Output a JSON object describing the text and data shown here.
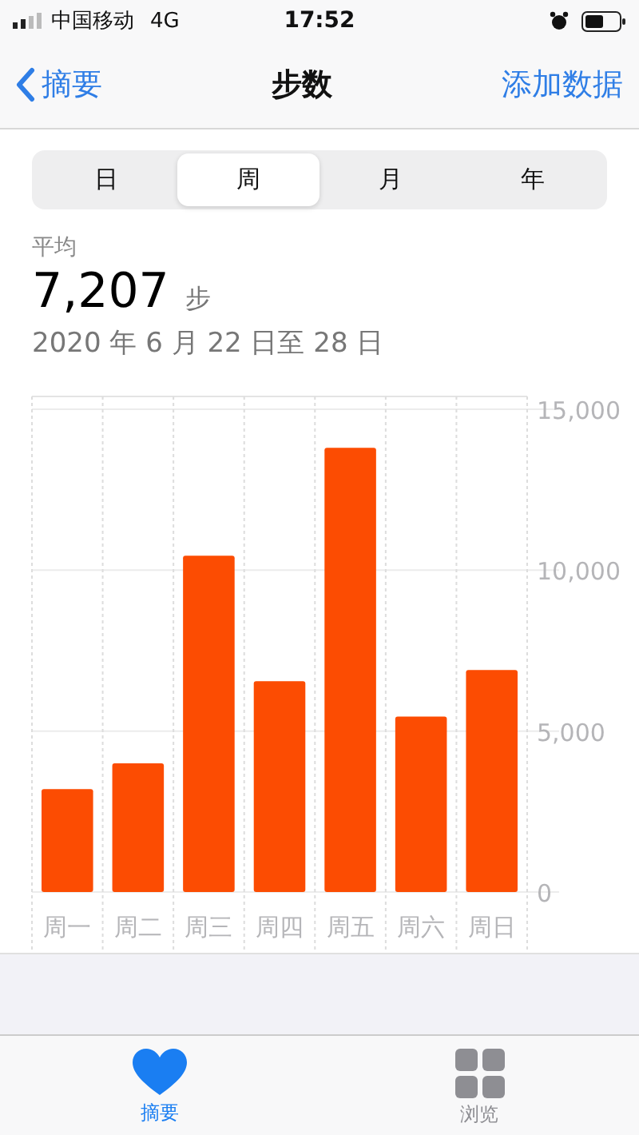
{
  "status_bar": {
    "carrier": "中国移动",
    "network": "4G",
    "time": "17:52"
  },
  "nav": {
    "back": "摘要",
    "title": "步数",
    "action": "添加数据"
  },
  "tabs": [
    {
      "label": "日",
      "selected": false
    },
    {
      "label": "周",
      "selected": true
    },
    {
      "label": "月",
      "selected": false
    },
    {
      "label": "年",
      "selected": false
    }
  ],
  "summary": {
    "label": "平均",
    "value": "7,207",
    "unit": "步",
    "range": "2020 年 6 月 22 日至 28 日"
  },
  "chart_data": {
    "type": "bar",
    "categories": [
      "周一",
      "周二",
      "周三",
      "周四",
      "周五",
      "周六",
      "周日"
    ],
    "series": [
      {
        "color": "#fc4c02",
        "values": [
          3200,
          4000,
          10450,
          6550,
          13800,
          5450,
          6900
        ]
      }
    ],
    "ylim": [
      0,
      15000
    ],
    "yticks": [
      {
        "value": 0,
        "label": "0"
      },
      {
        "value": 5000,
        "label": "5,000"
      },
      {
        "value": 10000,
        "label": "10,000"
      },
      {
        "value": 15000,
        "label": "15,000"
      }
    ]
  },
  "tab_bar": [
    {
      "label": "摘要",
      "selected": true
    },
    {
      "label": "浏览",
      "selected": false
    }
  ]
}
